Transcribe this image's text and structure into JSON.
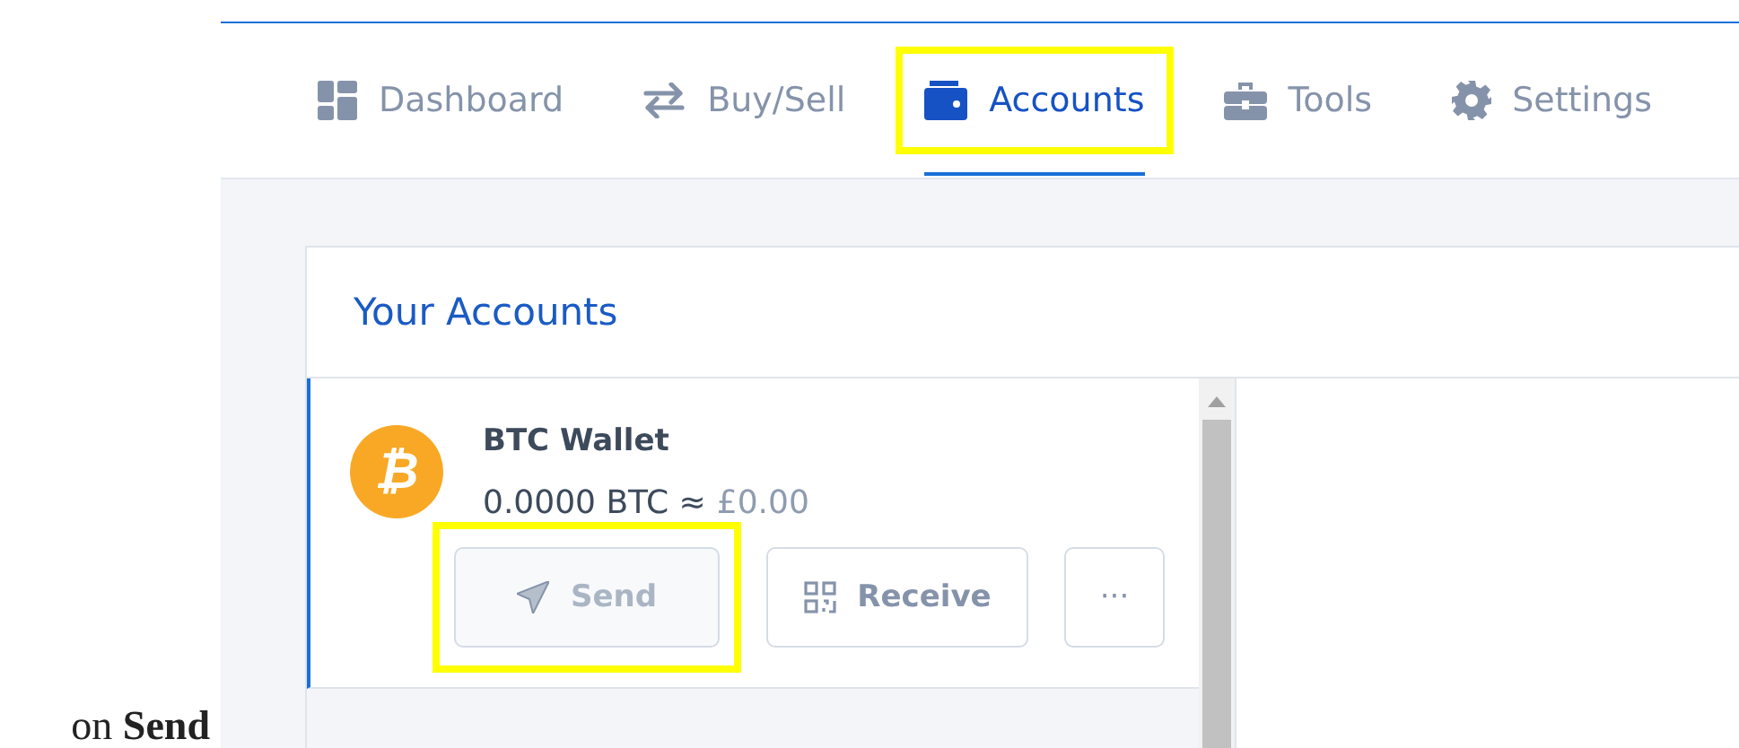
{
  "nav": {
    "tabs": [
      {
        "label": "Dashboard",
        "kind": "grid",
        "selected": false,
        "highlighted": false
      },
      {
        "label": "Buy/Sell",
        "kind": "swap",
        "selected": false,
        "highlighted": false
      },
      {
        "label": "Accounts",
        "kind": "wallet",
        "selected": true,
        "highlighted": true
      },
      {
        "label": "Tools",
        "kind": "toolbox",
        "selected": false,
        "highlighted": false
      },
      {
        "label": "Settings",
        "kind": "gear",
        "selected": false,
        "highlighted": false
      }
    ]
  },
  "accounts": {
    "title": "Your Accounts",
    "wallets": [
      {
        "symbol": "₿",
        "name": "BTC Wallet",
        "balance": "0.0000 BTC ≈",
        "fiat": "£0.00",
        "selected": true,
        "buttons": [
          {
            "kind": "send",
            "label": "Send",
            "disabled": true,
            "highlighted": true
          },
          {
            "kind": "receive",
            "label": "Receive",
            "disabled": false,
            "highlighted": false
          },
          {
            "kind": "more",
            "label": "···",
            "disabled": false,
            "highlighted": false
          }
        ]
      }
    ]
  },
  "caption": "on **Send**"
}
